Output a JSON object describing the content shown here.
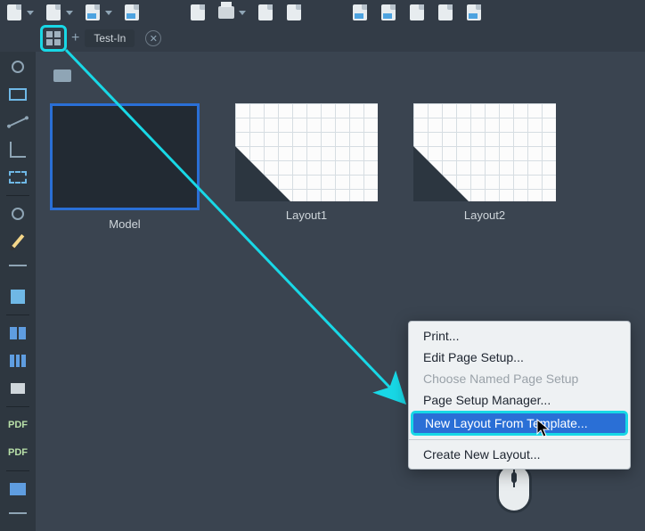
{
  "tabs": {
    "active": "Test-In"
  },
  "thumbnails": {
    "model": "Model",
    "layout1": "Layout1",
    "layout2": "Layout2"
  },
  "context_menu": {
    "print": "Print...",
    "edit_page_setup": "Edit Page Setup...",
    "choose_named_page_setup": "Choose Named Page Setup",
    "page_setup_manager": "Page Setup Manager...",
    "new_layout_from_template": "New Layout From Template...",
    "create_new_layout": "Create New Layout..."
  }
}
